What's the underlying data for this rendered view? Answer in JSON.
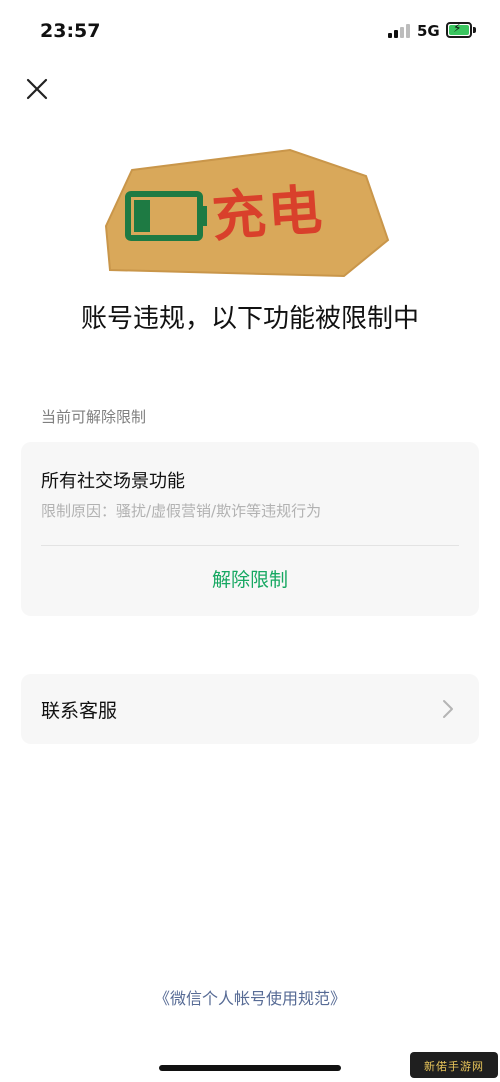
{
  "status_bar": {
    "time": "23:57",
    "network": "5G",
    "icons": [
      "signal-icon",
      "battery-charging-icon"
    ]
  },
  "header": {
    "close_icon": "close-icon"
  },
  "banner": {
    "text": "充电",
    "icon": "battery-icon",
    "colors": {
      "plate": "#d9a85a",
      "text": "#d9402b",
      "battery": "#1e7a43"
    }
  },
  "page_title": "账号违规，以下功能被限制中",
  "section_label": "当前可解除限制",
  "restriction_card": {
    "title": "所有社交场景功能",
    "reason": "限制原因：骚扰/虚假营销/欺诈等违规行为",
    "action_label": "解除限制"
  },
  "support": {
    "label": "联系客服",
    "icon": "chevron-right-icon"
  },
  "footer": {
    "rules_link": "《微信个人帐号使用规范》"
  },
  "watermark": {
    "text": "新偌手游网"
  },
  "colors": {
    "accent_green": "#17a862",
    "link_blue": "#576b95",
    "card_bg": "#f7f7f7"
  }
}
